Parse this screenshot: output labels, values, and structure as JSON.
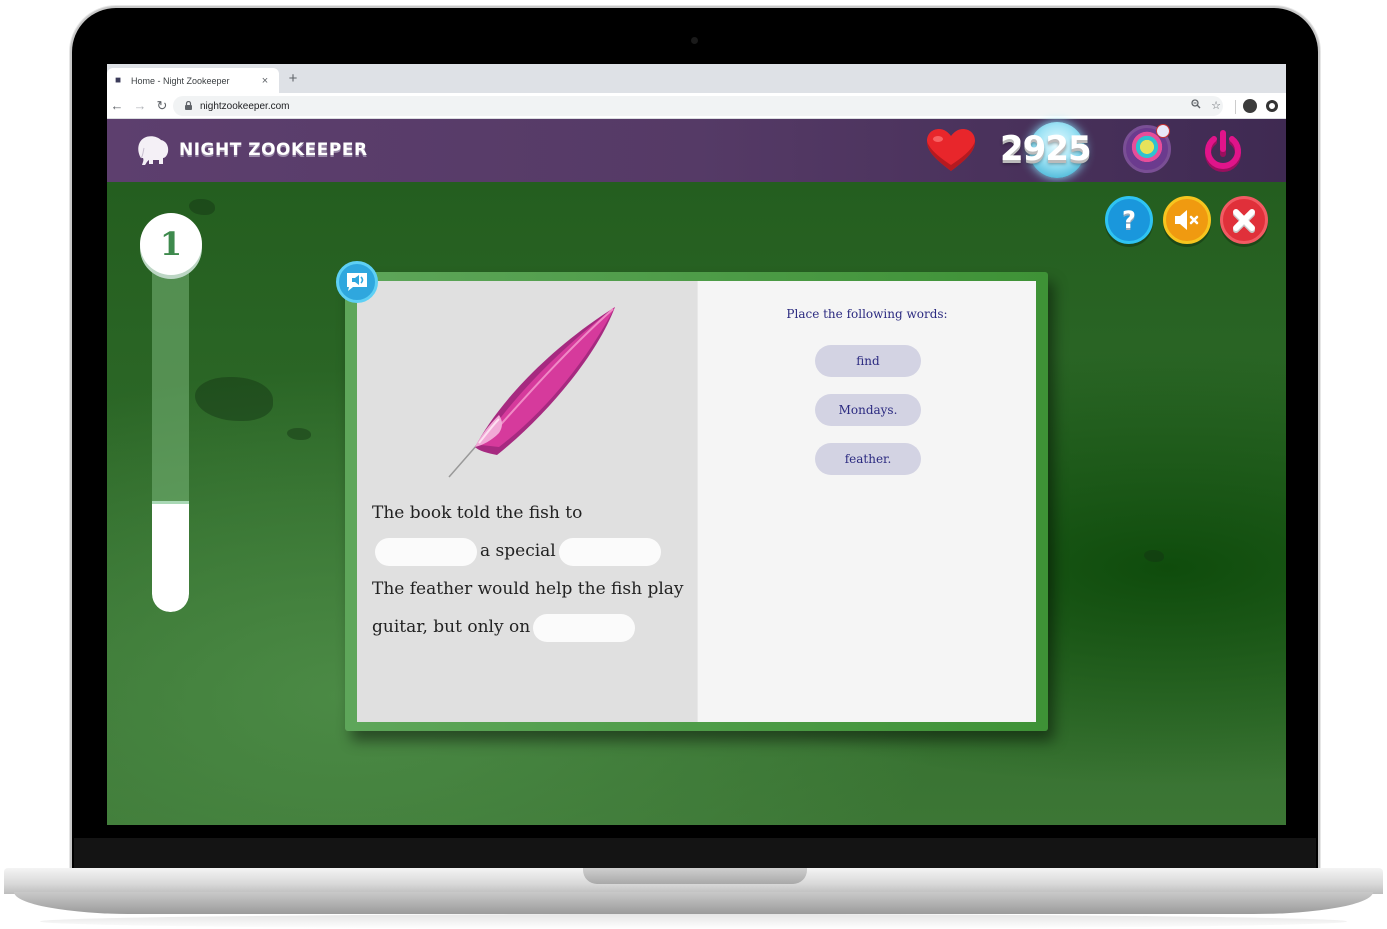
{
  "browser": {
    "tab_title": "Home - Night Zookeeper",
    "tab_close": "×",
    "new_tab": "+",
    "url": "nightzookeeper.com",
    "icons": {
      "back": "←",
      "forward": "→",
      "reload": "↻",
      "lock": "🔒",
      "zoom": "⊖",
      "bookmark": "☆"
    }
  },
  "header": {
    "logo_text": "NIGHT ZOOKEEPER",
    "score": "2925"
  },
  "controls": {
    "help_label": "?",
    "mute_label": "🔇",
    "close_label": "✕"
  },
  "progress": {
    "level": "1",
    "fraction": 0.32
  },
  "activity": {
    "sentence": [
      {
        "type": "text",
        "value": "The book told the fish to"
      },
      {
        "type": "blank"
      },
      {
        "type": "text",
        "value": "a special"
      },
      {
        "type": "blank"
      },
      {
        "type": "text",
        "value": "The feather would help the fish play guitar, but only on"
      },
      {
        "type": "blank"
      }
    ],
    "instructions": "Place the following words:",
    "words": [
      "find",
      "Mondays.",
      "feather."
    ]
  },
  "colors": {
    "header_purple": "#553a66",
    "card_green": "#3e9236",
    "word_text": "#2b2a80",
    "help_blue": "#1a97dc",
    "mute_orange": "#f09a10",
    "close_red": "#e0303a",
    "power_pink": "#e0148a"
  }
}
